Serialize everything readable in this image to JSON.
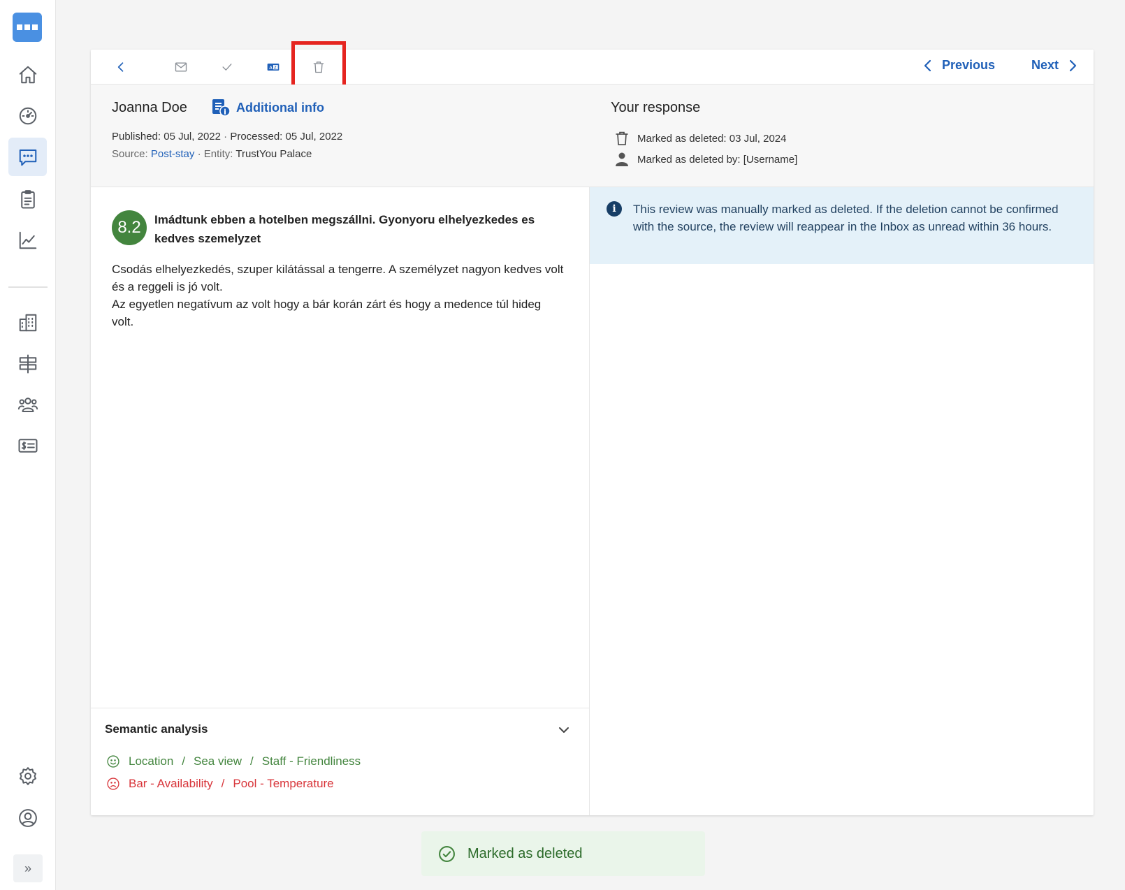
{
  "sidebar": {
    "items": [
      {
        "icon": "home-icon"
      },
      {
        "icon": "dashboard-icon"
      },
      {
        "icon": "reviews-chat-icon",
        "active": true
      },
      {
        "icon": "clipboard-icon"
      },
      {
        "icon": "analytics-chart-icon"
      },
      {
        "icon": "buildings-icon"
      },
      {
        "icon": "signpost-icon"
      },
      {
        "icon": "team-icon"
      },
      {
        "icon": "billing-icon"
      },
      {
        "icon": "settings-gear-icon"
      },
      {
        "icon": "account-icon"
      }
    ],
    "expand_label": "»"
  },
  "toolbar": {
    "icons": [
      "back-chevron-icon",
      "mail-icon",
      "check-icon",
      "translate-icon",
      "trash-icon"
    ],
    "previous_label": "Previous",
    "next_label": "Next"
  },
  "review": {
    "author": "Joanna Doe",
    "additional_info_label": "Additional info",
    "published_label": "Published:",
    "published_date": "05 Jul, 2022",
    "processed_label": "Processed:",
    "processed_date": "05 Jul, 2022",
    "source_label": "Source:",
    "source_value": "Post-stay",
    "entity_label": "Entity:",
    "entity_value": "TrustYou Palace",
    "score": "8.2",
    "title": "Imádtunk ebben a hotelben megszállni. Gyonyoru elhelyezkedes es kedves szemelyzet",
    "body_line1": "Csodás elhelyezkedés, szuper kilátással a tengerre. A személyzet nagyon kedves volt és a reggeli is jó volt.",
    "body_line2": "Az egyetlen negatívum az volt hogy a bár korán zárt és hogy a medence túl hideg volt."
  },
  "semantic": {
    "title": "Semantic analysis",
    "positive": [
      "Location",
      "Sea view",
      "Staff - Friendliness"
    ],
    "negative": [
      "Bar - Availability",
      "Pool - Temperature"
    ],
    "separator": "/",
    "colors": {
      "positive": "#43853e",
      "negative": "#d8353a"
    }
  },
  "response": {
    "title": "Your response",
    "deleted_line": "Marked as deleted: 03 Jul, 2024",
    "deleted_by_line": "Marked as deleted by: [Username]",
    "banner_text": "This review was manually marked as deleted. If the deletion cannot be confirmed with the source, the review will reappear in the Inbox as unread within 36 hours.",
    "banner_icon_glyph": "i"
  },
  "toast": {
    "text": "Marked as deleted"
  },
  "colors": {
    "accent": "#2060b8",
    "highlight": "#e5241f",
    "score_bg": "#43853e",
    "banner_bg": "#e4f1f9"
  }
}
